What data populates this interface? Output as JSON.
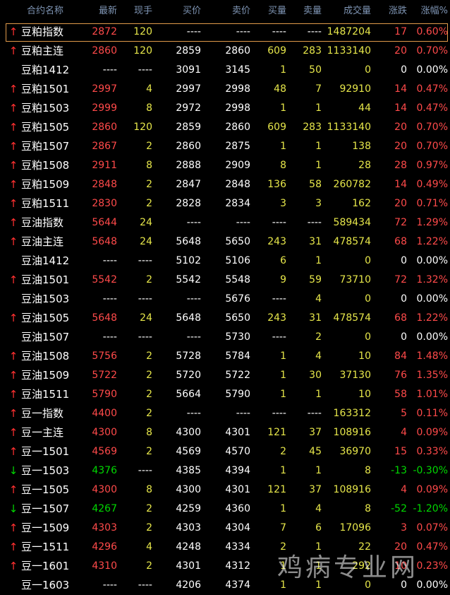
{
  "header": {
    "name": "合约名称",
    "last": "最新",
    "vol": "现手",
    "bid": "买价",
    "ask": "卖价",
    "bid_vol": "买量",
    "ask_vol": "卖量",
    "volume": "成交量",
    "change": "涨跌",
    "pct": "涨幅%"
  },
  "colors": {
    "up": "#ff4a4a",
    "down": "#00d800",
    "neutral": "#ffffff",
    "volume": "#e6e64a",
    "header": "#7e94b3",
    "selection": "#e09a4a"
  },
  "selected_row": 0,
  "rows": [
    {
      "arrow": "up",
      "name": "豆粕指数",
      "last": "2872",
      "vol": "120",
      "bid": "----",
      "ask": "----",
      "bid_vol": "----",
      "ask_vol": "----",
      "volume": "1487204",
      "change": "17",
      "pct": "0.60%",
      "dir": "up"
    },
    {
      "arrow": "up",
      "name": "豆粕主连",
      "last": "2860",
      "vol": "120",
      "bid": "2859",
      "ask": "2860",
      "bid_vol": "609",
      "ask_vol": "283",
      "volume": "1133140",
      "change": "20",
      "pct": "0.70%",
      "dir": "up"
    },
    {
      "arrow": "",
      "name": "豆粕1412",
      "last": "----",
      "vol": "----",
      "bid": "3091",
      "ask": "3145",
      "bid_vol": "1",
      "ask_vol": "50",
      "volume": "0",
      "change": "0",
      "pct": "0.00%",
      "dir": "flat"
    },
    {
      "arrow": "up",
      "name": "豆粕1501",
      "last": "2997",
      "vol": "4",
      "bid": "2997",
      "ask": "2998",
      "bid_vol": "48",
      "ask_vol": "7",
      "volume": "92910",
      "change": "14",
      "pct": "0.47%",
      "dir": "up"
    },
    {
      "arrow": "up",
      "name": "豆粕1503",
      "last": "2999",
      "vol": "8",
      "bid": "2972",
      "ask": "2998",
      "bid_vol": "1",
      "ask_vol": "1",
      "volume": "44",
      "change": "14",
      "pct": "0.47%",
      "dir": "up"
    },
    {
      "arrow": "up",
      "name": "豆粕1505",
      "last": "2860",
      "vol": "120",
      "bid": "2859",
      "ask": "2860",
      "bid_vol": "609",
      "ask_vol": "283",
      "volume": "1133140",
      "change": "20",
      "pct": "0.70%",
      "dir": "up"
    },
    {
      "arrow": "up",
      "name": "豆粕1507",
      "last": "2867",
      "vol": "2",
      "bid": "2860",
      "ask": "2875",
      "bid_vol": "1",
      "ask_vol": "1",
      "volume": "138",
      "change": "20",
      "pct": "0.70%",
      "dir": "up"
    },
    {
      "arrow": "up",
      "name": "豆粕1508",
      "last": "2911",
      "vol": "8",
      "bid": "2888",
      "ask": "2909",
      "bid_vol": "8",
      "ask_vol": "1",
      "volume": "28",
      "change": "28",
      "pct": "0.97%",
      "dir": "up"
    },
    {
      "arrow": "up",
      "name": "豆粕1509",
      "last": "2848",
      "vol": "2",
      "bid": "2847",
      "ask": "2848",
      "bid_vol": "136",
      "ask_vol": "58",
      "volume": "260782",
      "change": "14",
      "pct": "0.49%",
      "dir": "up"
    },
    {
      "arrow": "up",
      "name": "豆粕1511",
      "last": "2830",
      "vol": "2",
      "bid": "2828",
      "ask": "2834",
      "bid_vol": "3",
      "ask_vol": "3",
      "volume": "162",
      "change": "20",
      "pct": "0.71%",
      "dir": "up"
    },
    {
      "arrow": "up",
      "name": "豆油指数",
      "last": "5644",
      "vol": "24",
      "bid": "----",
      "ask": "----",
      "bid_vol": "----",
      "ask_vol": "----",
      "volume": "589434",
      "change": "72",
      "pct": "1.29%",
      "dir": "up"
    },
    {
      "arrow": "up",
      "name": "豆油主连",
      "last": "5648",
      "vol": "24",
      "bid": "5648",
      "ask": "5650",
      "bid_vol": "243",
      "ask_vol": "31",
      "volume": "478574",
      "change": "68",
      "pct": "1.22%",
      "dir": "up"
    },
    {
      "arrow": "",
      "name": "豆油1412",
      "last": "----",
      "vol": "----",
      "bid": "5102",
      "ask": "5106",
      "bid_vol": "6",
      "ask_vol": "1",
      "volume": "0",
      "change": "0",
      "pct": "0.00%",
      "dir": "flat"
    },
    {
      "arrow": "up",
      "name": "豆油1501",
      "last": "5542",
      "vol": "2",
      "bid": "5542",
      "ask": "5548",
      "bid_vol": "9",
      "ask_vol": "59",
      "volume": "73710",
      "change": "72",
      "pct": "1.32%",
      "dir": "up"
    },
    {
      "arrow": "",
      "name": "豆油1503",
      "last": "----",
      "vol": "----",
      "bid": "----",
      "ask": "5676",
      "bid_vol": "----",
      "ask_vol": "4",
      "volume": "0",
      "change": "0",
      "pct": "0.00%",
      "dir": "flat"
    },
    {
      "arrow": "up",
      "name": "豆油1505",
      "last": "5648",
      "vol": "24",
      "bid": "5648",
      "ask": "5650",
      "bid_vol": "243",
      "ask_vol": "31",
      "volume": "478574",
      "change": "68",
      "pct": "1.22%",
      "dir": "up"
    },
    {
      "arrow": "",
      "name": "豆油1507",
      "last": "----",
      "vol": "----",
      "bid": "----",
      "ask": "5730",
      "bid_vol": "----",
      "ask_vol": "2",
      "volume": "0",
      "change": "0",
      "pct": "0.00%",
      "dir": "flat"
    },
    {
      "arrow": "up",
      "name": "豆油1508",
      "last": "5756",
      "vol": "2",
      "bid": "5728",
      "ask": "5784",
      "bid_vol": "1",
      "ask_vol": "4",
      "volume": "10",
      "change": "84",
      "pct": "1.48%",
      "dir": "up"
    },
    {
      "arrow": "up",
      "name": "豆油1509",
      "last": "5722",
      "vol": "2",
      "bid": "5720",
      "ask": "5722",
      "bid_vol": "1",
      "ask_vol": "30",
      "volume": "37130",
      "change": "76",
      "pct": "1.35%",
      "dir": "up"
    },
    {
      "arrow": "up",
      "name": "豆油1511",
      "last": "5790",
      "vol": "2",
      "bid": "5664",
      "ask": "5790",
      "bid_vol": "1",
      "ask_vol": "1",
      "volume": "10",
      "change": "58",
      "pct": "1.01%",
      "dir": "up"
    },
    {
      "arrow": "up",
      "name": "豆一指数",
      "last": "4400",
      "vol": "2",
      "bid": "----",
      "ask": "----",
      "bid_vol": "----",
      "ask_vol": "----",
      "volume": "163312",
      "change": "5",
      "pct": "0.11%",
      "dir": "up"
    },
    {
      "arrow": "up",
      "name": "豆一主连",
      "last": "4300",
      "vol": "8",
      "bid": "4300",
      "ask": "4301",
      "bid_vol": "121",
      "ask_vol": "37",
      "volume": "108916",
      "change": "4",
      "pct": "0.09%",
      "dir": "up"
    },
    {
      "arrow": "up",
      "name": "豆一1501",
      "last": "4569",
      "vol": "2",
      "bid": "4569",
      "ask": "4570",
      "bid_vol": "2",
      "ask_vol": "45",
      "volume": "36970",
      "change": "15",
      "pct": "0.33%",
      "dir": "up"
    },
    {
      "arrow": "down",
      "name": "豆一1503",
      "last": "4376",
      "vol": "----",
      "bid": "4385",
      "ask": "4394",
      "bid_vol": "1",
      "ask_vol": "1",
      "volume": "8",
      "change": "-13",
      "pct": "-0.30%",
      "dir": "down"
    },
    {
      "arrow": "up",
      "name": "豆一1505",
      "last": "4300",
      "vol": "8",
      "bid": "4300",
      "ask": "4301",
      "bid_vol": "121",
      "ask_vol": "37",
      "volume": "108916",
      "change": "4",
      "pct": "0.09%",
      "dir": "up"
    },
    {
      "arrow": "down",
      "name": "豆一1507",
      "last": "4267",
      "vol": "2",
      "bid": "4259",
      "ask": "4360",
      "bid_vol": "1",
      "ask_vol": "4",
      "volume": "8",
      "change": "-52",
      "pct": "-1.20%",
      "dir": "down"
    },
    {
      "arrow": "up",
      "name": "豆一1509",
      "last": "4303",
      "vol": "2",
      "bid": "4303",
      "ask": "4304",
      "bid_vol": "7",
      "ask_vol": "6",
      "volume": "17096",
      "change": "3",
      "pct": "0.07%",
      "dir": "up"
    },
    {
      "arrow": "up",
      "name": "豆一1511",
      "last": "4296",
      "vol": "4",
      "bid": "4248",
      "ask": "4334",
      "bid_vol": "2",
      "ask_vol": "1",
      "volume": "22",
      "change": "20",
      "pct": "0.47%",
      "dir": "up"
    },
    {
      "arrow": "up",
      "name": "豆一1601",
      "last": "4310",
      "vol": "2",
      "bid": "4301",
      "ask": "4312",
      "bid_vol": "1",
      "ask_vol": "1",
      "volume": "292",
      "change": "10",
      "pct": "0.23%",
      "dir": "up"
    },
    {
      "arrow": "",
      "name": "豆一1603",
      "last": "----",
      "vol": "----",
      "bid": "4206",
      "ask": "4374",
      "bid_vol": "1",
      "ask_vol": "1",
      "volume": "0",
      "change": "0",
      "pct": "0.00%",
      "dir": "flat"
    }
  ],
  "watermark": "鸡病专业网"
}
